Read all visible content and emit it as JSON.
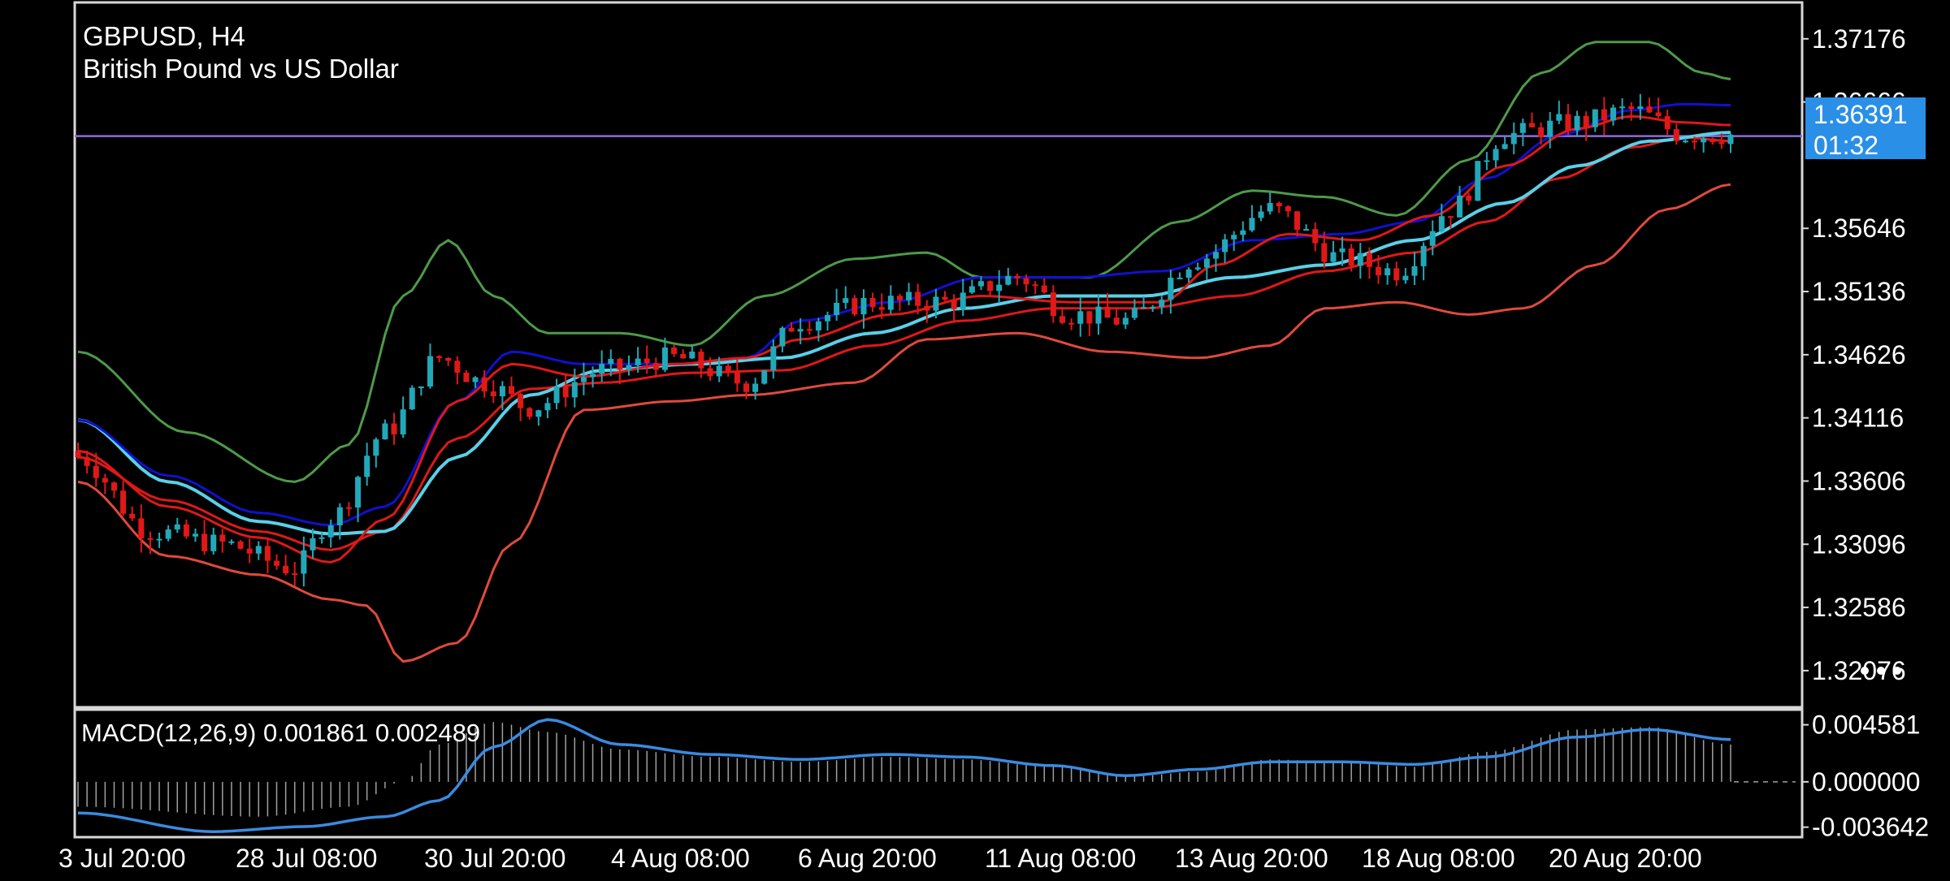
{
  "window": {
    "symbol_title": "GBPUSD, H4",
    "description": "British Pound vs US Dollar"
  },
  "price_label": {
    "value": "1.36391",
    "timer": "01:32"
  },
  "colors": {
    "background": "#000000",
    "frame": "#d8d8d8",
    "candle_up": "#22a8b8",
    "candle_down": "#e01818",
    "bb_upper": "#4e9a4a",
    "bb_lower": "#e04a3c",
    "ma_blue": "#1010d0",
    "ma_cyan": "#5ad0e8",
    "ma_red": "#e01818",
    "bid_line": "#8c6cd8",
    "price_box": "#2a8fe6",
    "macd_signal": "#3a8ae0",
    "macd_hist": "#a0a0a0"
  },
  "chart_data": [
    {
      "type": "candlestick",
      "name": "main",
      "ylim": [
        1.318,
        1.3745
      ],
      "y_ticks": [
        "1.37176",
        "1.36666",
        "1.35646",
        "1.35136",
        "1.34626",
        "1.34116",
        "1.33606",
        "1.33096",
        "1.32586",
        "1.32076"
      ],
      "y_tick_values": [
        1.37176,
        1.36666,
        1.35646,
        1.35136,
        1.34626,
        1.34116,
        1.33606,
        1.33096,
        1.32586,
        1.32076
      ],
      "x_labels": [
        "3 Jul 20:00",
        "28 Jul 08:00",
        "30 Jul 20:00",
        "4 Aug 08:00",
        "6 Aug 20:00",
        "11 Aug 08:00",
        "13 Aug 20:00",
        "18 Aug 08:00",
        "20 Aug 20:00"
      ],
      "current_price": 1.36391,
      "anchors": {
        "close": [
          [
            0,
            1.338
          ],
          [
            8,
            1.332
          ],
          [
            16,
            1.331
          ],
          [
            24,
            1.329
          ],
          [
            28,
            1.333
          ],
          [
            34,
            1.34
          ],
          [
            40,
            1.346
          ],
          [
            45,
            1.344
          ],
          [
            50,
            1.342
          ],
          [
            58,
            1.345
          ],
          [
            66,
            1.346
          ],
          [
            74,
            1.344
          ],
          [
            80,
            1.349
          ],
          [
            88,
            1.3505
          ],
          [
            96,
            1.3505
          ],
          [
            104,
            1.3525
          ],
          [
            110,
            1.3495
          ],
          [
            116,
            1.349
          ],
          [
            124,
            1.354
          ],
          [
            132,
            1.358
          ],
          [
            140,
            1.354
          ],
          [
            146,
            1.353
          ],
          [
            152,
            1.358
          ],
          [
            158,
            1.364
          ],
          [
            166,
            1.365
          ],
          [
            172,
            1.366
          ],
          [
            178,
            1.364
          ],
          [
            183,
            1.364
          ]
        ],
        "bb_upper": [
          [
            0,
            1.3465
          ],
          [
            12,
            1.34
          ],
          [
            24,
            1.336
          ],
          [
            30,
            1.339
          ],
          [
            36,
            1.351
          ],
          [
            41,
            1.3555
          ],
          [
            46,
            1.351
          ],
          [
            52,
            1.348
          ],
          [
            60,
            1.348
          ],
          [
            68,
            1.347
          ],
          [
            76,
            1.351
          ],
          [
            86,
            1.354
          ],
          [
            94,
            1.3545
          ],
          [
            100,
            1.3525
          ],
          [
            112,
            1.3525
          ],
          [
            122,
            1.357
          ],
          [
            130,
            1.3595
          ],
          [
            138,
            1.359
          ],
          [
            146,
            1.3575
          ],
          [
            154,
            1.362
          ],
          [
            162,
            1.369
          ],
          [
            168,
            1.3715
          ],
          [
            174,
            1.3715
          ],
          [
            180,
            1.369
          ],
          [
            183,
            1.3685
          ]
        ],
        "bb_lower": [
          [
            0,
            1.336
          ],
          [
            10,
            1.33
          ],
          [
            20,
            1.3285
          ],
          [
            28,
            1.3265
          ],
          [
            32,
            1.326
          ],
          [
            36,
            1.3215
          ],
          [
            42,
            1.323
          ],
          [
            48,
            1.331
          ],
          [
            56,
            1.3418
          ],
          [
            66,
            1.3425
          ],
          [
            74,
            1.343
          ],
          [
            86,
            1.344
          ],
          [
            94,
            1.3475
          ],
          [
            104,
            1.348
          ],
          [
            114,
            1.3465
          ],
          [
            124,
            1.346
          ],
          [
            132,
            1.347
          ],
          [
            138,
            1.35
          ],
          [
            146,
            1.3505
          ],
          [
            154,
            1.3495
          ],
          [
            160,
            1.35
          ],
          [
            168,
            1.3535
          ],
          [
            176,
            1.358
          ],
          [
            183,
            1.36
          ]
        ],
        "ma_blue": [
          [
            0,
            1.341
          ],
          [
            10,
            1.3365
          ],
          [
            20,
            1.3335
          ],
          [
            28,
            1.3325
          ],
          [
            34,
            1.334
          ],
          [
            42,
            1.3425
          ],
          [
            48,
            1.3465
          ],
          [
            56,
            1.3455
          ],
          [
            66,
            1.3455
          ],
          [
            74,
            1.346
          ],
          [
            80,
            1.349
          ],
          [
            90,
            1.3505
          ],
          [
            100,
            1.3525
          ],
          [
            110,
            1.3525
          ],
          [
            120,
            1.353
          ],
          [
            130,
            1.3555
          ],
          [
            140,
            1.356
          ],
          [
            148,
            1.357
          ],
          [
            156,
            1.3605
          ],
          [
            164,
            1.364
          ],
          [
            172,
            1.366
          ],
          [
            178,
            1.3665
          ],
          [
            183,
            1.3664
          ]
        ],
        "ma_cyan": [
          [
            0,
            1.341
          ],
          [
            10,
            1.336
          ],
          [
            20,
            1.3328
          ],
          [
            28,
            1.3318
          ],
          [
            34,
            1.332
          ],
          [
            42,
            1.338
          ],
          [
            50,
            1.343
          ],
          [
            58,
            1.345
          ],
          [
            68,
            1.3455
          ],
          [
            78,
            1.346
          ],
          [
            88,
            1.348
          ],
          [
            98,
            1.35
          ],
          [
            108,
            1.351
          ],
          [
            118,
            1.351
          ],
          [
            128,
            1.3525
          ],
          [
            138,
            1.3535
          ],
          [
            148,
            1.3555
          ],
          [
            158,
            1.3585
          ],
          [
            166,
            1.3615
          ],
          [
            174,
            1.3635
          ],
          [
            183,
            1.3642
          ]
        ],
        "ma_red1": [
          [
            0,
            1.3385
          ],
          [
            10,
            1.334
          ],
          [
            20,
            1.3315
          ],
          [
            28,
            1.3295
          ],
          [
            34,
            1.333
          ],
          [
            42,
            1.3425
          ],
          [
            48,
            1.3455
          ],
          [
            56,
            1.3445
          ],
          [
            66,
            1.3455
          ],
          [
            74,
            1.346
          ],
          [
            80,
            1.3475
          ],
          [
            90,
            1.3495
          ],
          [
            100,
            1.351
          ],
          [
            110,
            1.3505
          ],
          [
            120,
            1.3505
          ],
          [
            126,
            1.3535
          ],
          [
            134,
            1.356
          ],
          [
            142,
            1.3555
          ],
          [
            150,
            1.3575
          ],
          [
            158,
            1.3615
          ],
          [
            166,
            1.3645
          ],
          [
            172,
            1.3655
          ],
          [
            178,
            1.365
          ],
          [
            183,
            1.3648
          ]
        ],
        "ma_red2": [
          [
            0,
            1.338
          ],
          [
            10,
            1.3345
          ],
          [
            20,
            1.332
          ],
          [
            28,
            1.3305
          ],
          [
            34,
            1.332
          ],
          [
            42,
            1.3395
          ],
          [
            50,
            1.3435
          ],
          [
            58,
            1.344
          ],
          [
            68,
            1.3448
          ],
          [
            78,
            1.345
          ],
          [
            88,
            1.347
          ],
          [
            98,
            1.349
          ],
          [
            108,
            1.35
          ],
          [
            118,
            1.35
          ],
          [
            128,
            1.351
          ],
          [
            138,
            1.353
          ],
          [
            148,
            1.3545
          ],
          [
            156,
            1.357
          ],
          [
            164,
            1.3605
          ],
          [
            172,
            1.363
          ],
          [
            178,
            1.3638
          ],
          [
            183,
            1.3635
          ]
        ]
      },
      "series_count": 184
    },
    {
      "type": "macd",
      "name": "MACD(12,26,9)",
      "label": "MACD(12,26,9) 0.001861 0.002489",
      "main_value": 0.001861,
      "signal_value": 0.002489,
      "ylim": [
        -0.00425,
        0.0056
      ],
      "y_ticks": [
        "0.004581",
        "0.000000",
        "-0.003642"
      ],
      "y_tick_values": [
        0.004581,
        0.0,
        -0.003642
      ],
      "hist_anchors": [
        [
          0,
          -0.002
        ],
        [
          20,
          -0.0028
        ],
        [
          30,
          -0.002
        ],
        [
          36,
          0.0
        ],
        [
          40,
          0.003
        ],
        [
          46,
          0.0048
        ],
        [
          52,
          0.004
        ],
        [
          60,
          0.0026
        ],
        [
          70,
          0.002
        ],
        [
          80,
          0.0016
        ],
        [
          90,
          0.002
        ],
        [
          98,
          0.0018
        ],
        [
          108,
          0.0012
        ],
        [
          116,
          0.0004
        ],
        [
          124,
          0.0008
        ],
        [
          132,
          0.0018
        ],
        [
          140,
          0.0016
        ],
        [
          148,
          0.0012
        ],
        [
          156,
          0.0024
        ],
        [
          166,
          0.0042
        ],
        [
          174,
          0.0044
        ],
        [
          183,
          0.003
        ]
      ],
      "signal_anchors": [
        [
          0,
          -0.0025
        ],
        [
          15,
          -0.004
        ],
        [
          25,
          -0.0036
        ],
        [
          34,
          -0.0028
        ],
        [
          40,
          -0.0015
        ],
        [
          46,
          0.0028
        ],
        [
          52,
          0.005
        ],
        [
          60,
          0.003
        ],
        [
          70,
          0.0022
        ],
        [
          80,
          0.0018
        ],
        [
          90,
          0.0022
        ],
        [
          98,
          0.002
        ],
        [
          108,
          0.0013
        ],
        [
          116,
          0.0005
        ],
        [
          124,
          0.001
        ],
        [
          132,
          0.0016
        ],
        [
          140,
          0.0016
        ],
        [
          148,
          0.0014
        ],
        [
          156,
          0.002
        ],
        [
          166,
          0.0036
        ],
        [
          174,
          0.0042
        ],
        [
          183,
          0.0034
        ]
      ]
    }
  ]
}
